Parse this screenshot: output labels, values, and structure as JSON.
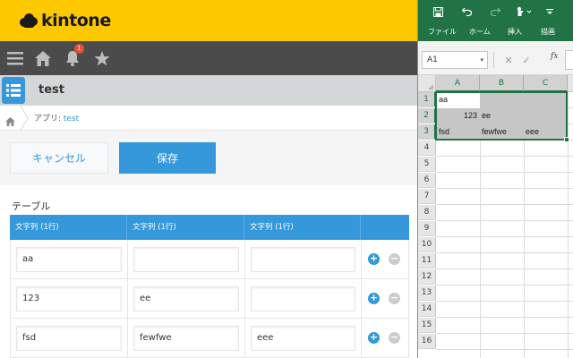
{
  "kintone": {
    "brand": "kintone",
    "nav": {
      "notification_count": "1"
    },
    "app_title": "test",
    "breadcrumb": {
      "prefix": "アプリ: ",
      "app_link": "test"
    },
    "buttons": {
      "cancel": "キャンセル",
      "save": "保存"
    },
    "table": {
      "label": "テーブル",
      "headers": [
        "文字列 (1行)",
        "文字列 (1行)",
        "文字列 (1行)"
      ],
      "rows": [
        [
          "aa",
          "",
          ""
        ],
        [
          "123",
          "ee",
          ""
        ],
        [
          "fsd",
          "fewfwe",
          "eee"
        ]
      ],
      "add_symbol": "+",
      "remove_symbol": "−"
    },
    "colors": {
      "header_yellow": "#fcc800",
      "nav_dark": "#4b4b4b",
      "accent_blue": "#3498db"
    }
  },
  "excel": {
    "tabs": [
      "ファイル",
      "ホーム",
      "挿入",
      "描画"
    ],
    "name_box": "A1",
    "fx_label": "fx",
    "columns": [
      "A",
      "B",
      "C"
    ],
    "row_numbers": [
      "1",
      "2",
      "3",
      "4",
      "5",
      "6",
      "7",
      "8",
      "9",
      "10",
      "11",
      "12",
      "13",
      "14",
      "15",
      "16"
    ],
    "cells": {
      "A1": "aa",
      "A2": "123",
      "B2": "ee",
      "A3": "fsd",
      "B3": "fewfwe",
      "C3": "eee"
    },
    "colors": {
      "ribbon_green": "#217346"
    }
  }
}
